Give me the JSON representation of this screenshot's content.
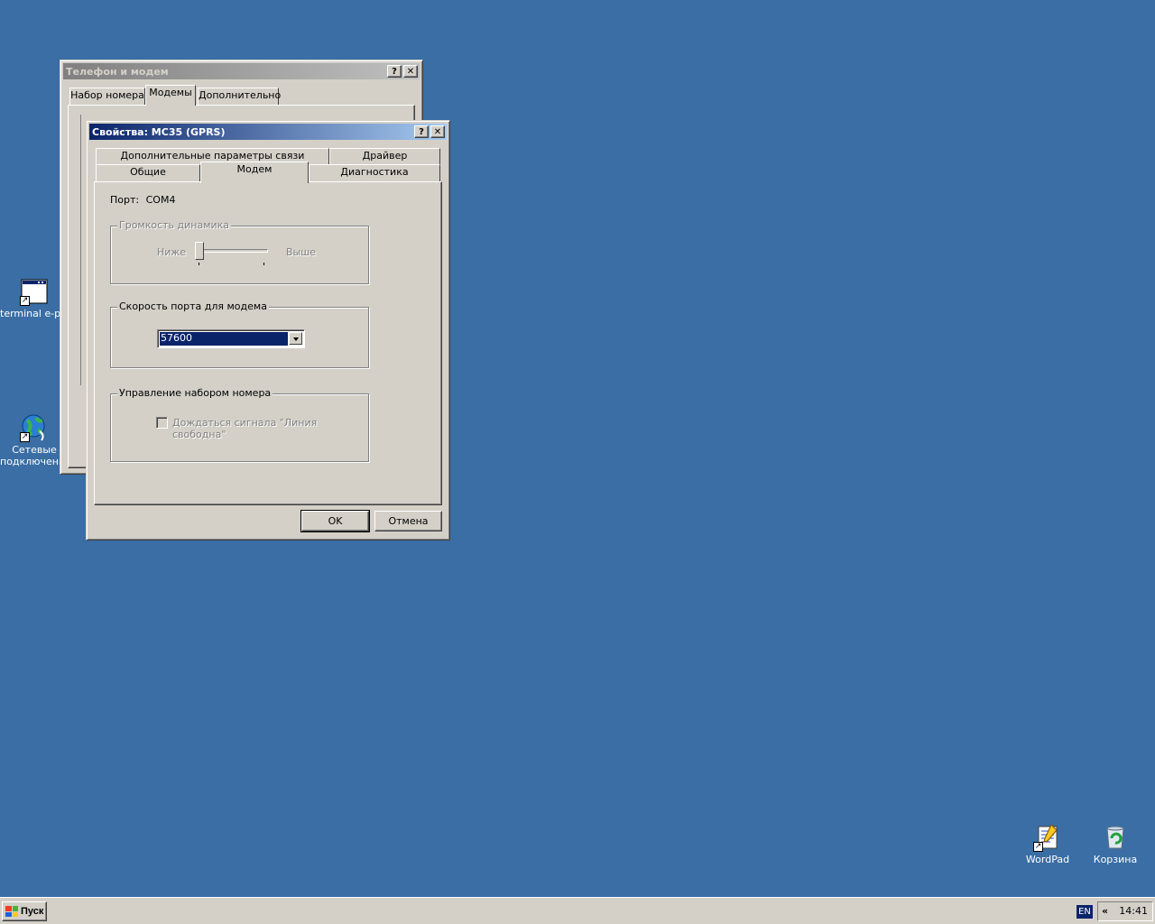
{
  "desktop": {
    "icons": {
      "terminal": "terminal e-port",
      "network": "Сетевые подключения",
      "wordpad": "WordPad",
      "recycle": "Корзина"
    }
  },
  "back_window": {
    "title": "Телефон и модем",
    "help_label": "?",
    "close_label": "✕",
    "tabs": [
      "Набор номера",
      "Модемы",
      "Дополнительно"
    ],
    "selected_tab": "Модемы"
  },
  "dialog": {
    "title": "Свойства: MC35 (GPRS)",
    "help_label": "?",
    "close_label": "✕",
    "tabs_row1": [
      "Дополнительные параметры связи",
      "Драйвер"
    ],
    "tabs_row2": [
      "Общие",
      "Модем",
      "Диагностика"
    ],
    "selected_tab": "Модем",
    "port_label": "Порт:",
    "port_value": "COM4",
    "volume_group": "Громкость динамика",
    "volume_low": "Ниже",
    "volume_high": "Выше",
    "volume_level": 0,
    "speed_group": "Скорость порта для модема",
    "speed_value": "57600",
    "dial_group": "Управление набором номера",
    "wait_dialtone_label": "Дождаться сигнала \"Линия свободна\"",
    "wait_dialtone_checked": false,
    "ok_label": "OK",
    "cancel_label": "Отмена"
  },
  "taskbar": {
    "start_label": "Пуск",
    "lang": "EN",
    "tray_expand": "«",
    "clock": "14:41",
    "logo_colors": [
      "#f03c24",
      "#4caf3c",
      "#2060d8",
      "#f8c820"
    ]
  }
}
